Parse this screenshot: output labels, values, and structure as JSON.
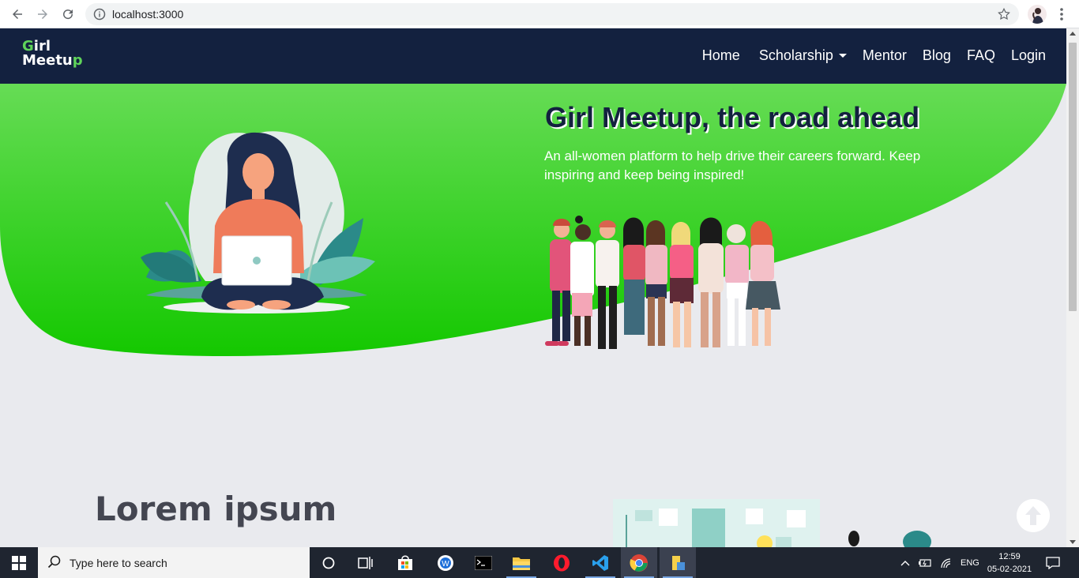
{
  "browser": {
    "url": "localhost:3000",
    "back_icon": "arrow-left-icon",
    "forward_icon": "arrow-right-icon",
    "reload_icon": "reload-icon"
  },
  "navbar": {
    "brand_line1": "Girl",
    "brand_line2": "Meetup",
    "links": [
      "Home",
      "Scholarship",
      "Mentor",
      "Blog",
      "FAQ",
      "Login"
    ],
    "bg_color": "#13213f"
  },
  "hero": {
    "title": "Girl Meetup, the road ahead",
    "subtitle": "An all-women platform to help drive their careers forward. Keep inspiring and keep being inspired!",
    "green": "#3fd11b"
  },
  "section": {
    "heading": "Lorem ipsum"
  },
  "taskbar": {
    "search_placeholder": "Type here to search",
    "language": "ENG",
    "time": "12:59",
    "date": "05-02-2021"
  }
}
